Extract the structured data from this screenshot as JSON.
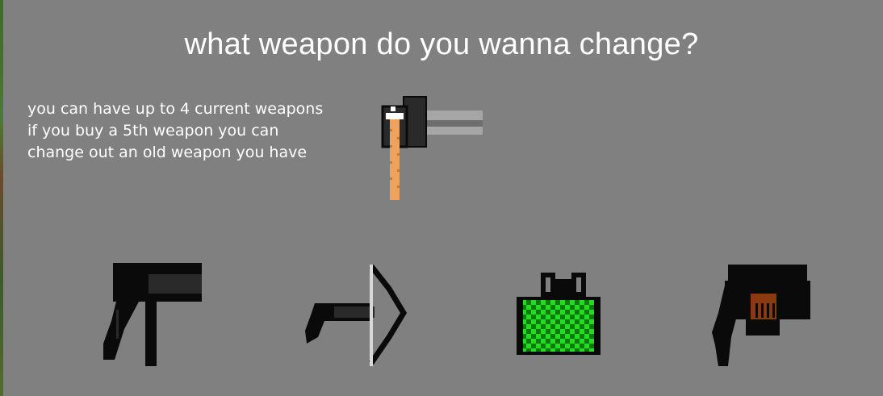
{
  "title": "what weapon do you wanna change?",
  "info_lines": [
    "you can have up to 4 current weapons",
    "if you buy a 5th weapon you can",
    "change out an old weapon you have"
  ],
  "new_weapon": {
    "icon": "shotgun-icon"
  },
  "weapon_slots": [
    {
      "icon": "pistol-icon"
    },
    {
      "icon": "crossbow-icon"
    },
    {
      "icon": "acid-bomb-icon"
    },
    {
      "icon": "flamethrower-icon"
    }
  ],
  "colors": {
    "background": "#808080",
    "text": "#ffffff",
    "weapon_black": "#0a0a0a",
    "weapon_dark": "#2a2a2a",
    "barrel_grey": "#a6a6a6",
    "handle_orange": "#f0a15a",
    "acid_green": "#22dd22",
    "acid_dark": "#0b7a0b",
    "rust": "#8b3a0f"
  }
}
